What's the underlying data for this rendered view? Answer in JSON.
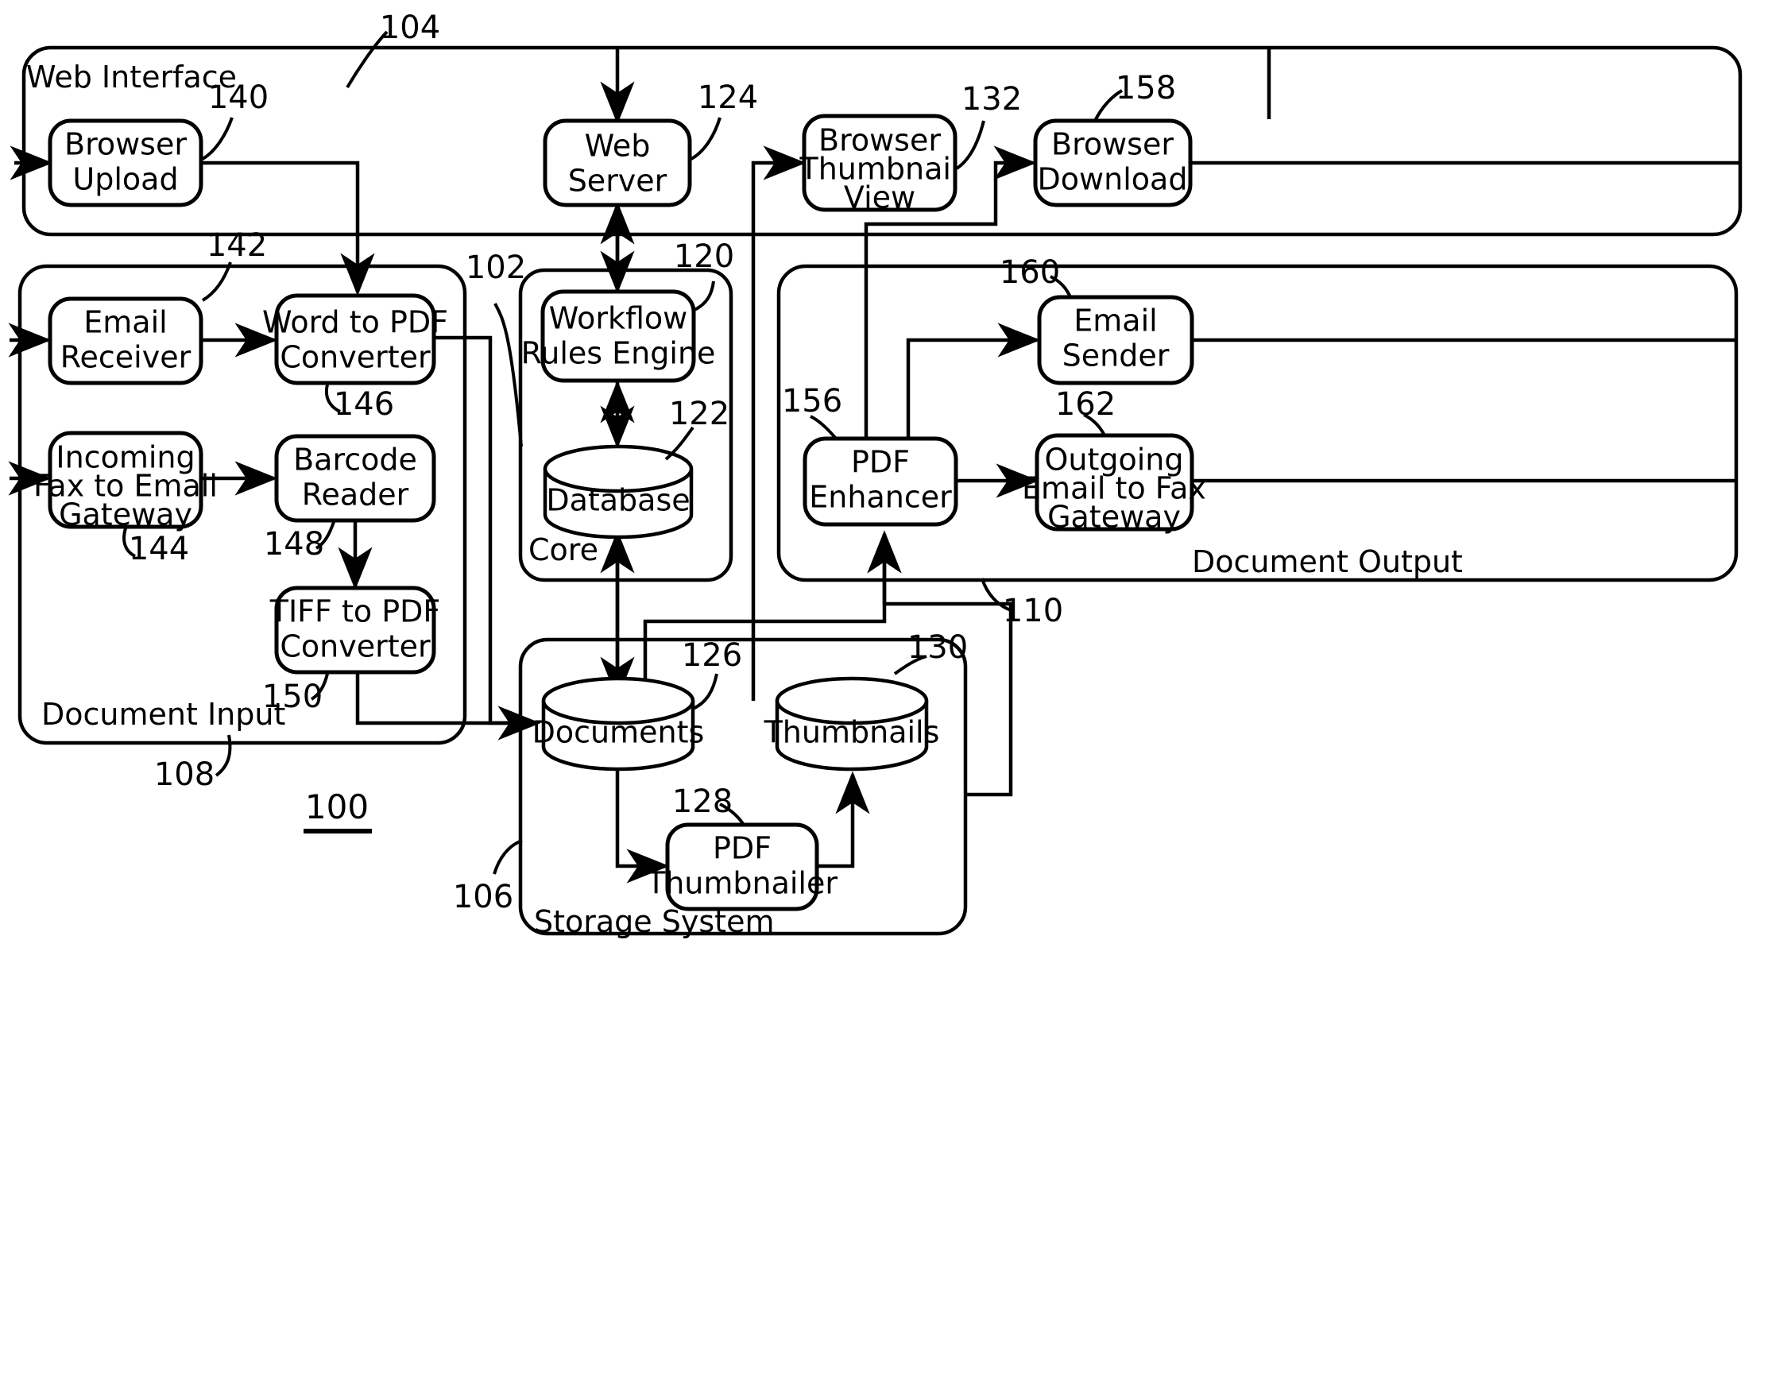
{
  "figure": {
    "figure_number": "100",
    "groups": [
      {
        "id": "web-interface",
        "label": "Web Interface",
        "ref": "104"
      },
      {
        "id": "document-input",
        "label": "Document Input",
        "ref": "108"
      },
      {
        "id": "core",
        "label": "Core",
        "ref": "102"
      },
      {
        "id": "document-output",
        "label": "Document Output",
        "ref": "110"
      },
      {
        "id": "storage-system",
        "label": "Storage System",
        "ref": "106"
      }
    ],
    "nodes": [
      {
        "id": "browser-upload",
        "label": "Browser Upload",
        "lines": [
          "Browser",
          "Upload"
        ],
        "ref": "140",
        "shape": "rounded-rect",
        "group": "web-interface"
      },
      {
        "id": "web-server",
        "label": "Web Server",
        "lines": [
          "Web",
          "Server"
        ],
        "ref": "124",
        "shape": "rounded-rect",
        "group": "web-interface"
      },
      {
        "id": "browser-thumbnail-view",
        "label": "Browser Thumbnail View",
        "lines": [
          "Browser",
          "Thumbnail",
          "View"
        ],
        "ref": "132",
        "shape": "rounded-rect",
        "group": "web-interface"
      },
      {
        "id": "browser-download",
        "label": "Browser Download",
        "lines": [
          "Browser",
          "Download"
        ],
        "ref": "158",
        "shape": "rounded-rect",
        "group": "web-interface"
      },
      {
        "id": "email-receiver",
        "label": "Email Receiver",
        "lines": [
          "Email",
          "Receiver"
        ],
        "ref": "142",
        "shape": "rounded-rect",
        "group": "document-input"
      },
      {
        "id": "word-to-pdf-converter",
        "label": "Word to PDF Converter",
        "lines": [
          "Word to PDF",
          "Converter"
        ],
        "ref": "146",
        "shape": "rounded-rect",
        "group": "document-input"
      },
      {
        "id": "incoming-fax-to-email-gateway",
        "label": "Incoming Fax to Email Gateway",
        "lines": [
          "Incoming",
          "Fax to Email",
          "Gateway"
        ],
        "ref": "144",
        "shape": "rounded-rect",
        "group": "document-input"
      },
      {
        "id": "barcode-reader",
        "label": "Barcode Reader",
        "lines": [
          "Barcode",
          "Reader"
        ],
        "ref": "148",
        "shape": "rounded-rect",
        "group": "document-input"
      },
      {
        "id": "tiff-to-pdf-converter",
        "label": "TIFF to PDF Converter",
        "lines": [
          "TIFF to PDF",
          "Converter"
        ],
        "ref": "150",
        "shape": "rounded-rect",
        "group": "document-input"
      },
      {
        "id": "workflow-rules-engine",
        "label": "Workflow Rules Engine",
        "lines": [
          "Workflow",
          "Rules Engine"
        ],
        "ref": "120",
        "shape": "rounded-rect",
        "group": "core"
      },
      {
        "id": "database",
        "label": "Database",
        "lines": [
          "Database"
        ],
        "ref": "122",
        "shape": "cylinder",
        "group": "core"
      },
      {
        "id": "pdf-enhancer",
        "label": "PDF Enhancer",
        "lines": [
          "PDF",
          "Enhancer"
        ],
        "ref": "156",
        "shape": "rounded-rect",
        "group": "document-output"
      },
      {
        "id": "email-sender",
        "label": "Email Sender",
        "lines": [
          "Email",
          "Sender"
        ],
        "ref": "160",
        "shape": "rounded-rect",
        "group": "document-output"
      },
      {
        "id": "outgoing-email-to-fax-gateway",
        "label": "Outgoing Email to Fax Gateway",
        "lines": [
          "Outgoing",
          "Email to Fax",
          "Gateway"
        ],
        "ref": "162",
        "shape": "rounded-rect",
        "group": "document-output"
      },
      {
        "id": "documents",
        "label": "Documents",
        "lines": [
          "Documents"
        ],
        "ref": "126",
        "shape": "cylinder",
        "group": "storage-system"
      },
      {
        "id": "thumbnails",
        "label": "Thumbnails",
        "lines": [
          "Thumbnails"
        ],
        "ref": "130",
        "shape": "cylinder",
        "group": "storage-system"
      },
      {
        "id": "pdf-thumbnailer",
        "label": "PDF Thumbnailer",
        "lines": [
          "PDF",
          "Thumbnailer"
        ],
        "ref": "128",
        "shape": "rounded-rect",
        "group": "storage-system"
      }
    ],
    "labels": {
      "web_interface": "Web Interface",
      "document_input": "Document Input",
      "core": "Core",
      "document_output": "Document Output",
      "storage_system": "Storage System",
      "browser_upload_l1": "Browser",
      "browser_upload_l2": "Upload",
      "web_server_l1": "Web",
      "web_server_l2": "Server",
      "browser_thumbnail_l1": "Browser",
      "browser_thumbnail_l2": "Thumbnail",
      "browser_thumbnail_l3": "View",
      "browser_download_l1": "Browser",
      "browser_download_l2": "Download",
      "email_receiver_l1": "Email",
      "email_receiver_l2": "Receiver",
      "word_to_pdf_l1": "Word to PDF",
      "word_to_pdf_l2": "Converter",
      "incoming_fax_l1": "Incoming",
      "incoming_fax_l2": "Fax to Email",
      "incoming_fax_l3": "Gateway",
      "barcode_reader_l1": "Barcode",
      "barcode_reader_l2": "Reader",
      "tiff_to_pdf_l1": "TIFF to PDF",
      "tiff_to_pdf_l2": "Converter",
      "workflow_l1": "Workflow",
      "workflow_l2": "Rules Engine",
      "database_l1": "Database",
      "pdf_enhancer_l1": "PDF",
      "pdf_enhancer_l2": "Enhancer",
      "email_sender_l1": "Email",
      "email_sender_l2": "Sender",
      "outgoing_fax_l1": "Outgoing",
      "outgoing_fax_l2": "Email to Fax",
      "outgoing_fax_l3": "Gateway",
      "documents_l1": "Documents",
      "thumbnails_l1": "Thumbnails",
      "pdf_thumbnailer_l1": "PDF",
      "pdf_thumbnailer_l2": "Thumbnailer"
    },
    "reference_numerals": {
      "n100": "100",
      "n102": "102",
      "n104": "104",
      "n106": "106",
      "n108": "108",
      "n110": "110",
      "n120": "120",
      "n122": "122",
      "n124": "124",
      "n126": "126",
      "n128": "128",
      "n130": "130",
      "n132": "132",
      "n140": "140",
      "n142": "142",
      "n144": "144",
      "n146": "146",
      "n148": "148",
      "n150": "150",
      "n156": "156",
      "n158": "158",
      "n160": "160",
      "n162": "162"
    },
    "colors": {
      "stroke": "#000000",
      "background": "#ffffff"
    }
  }
}
